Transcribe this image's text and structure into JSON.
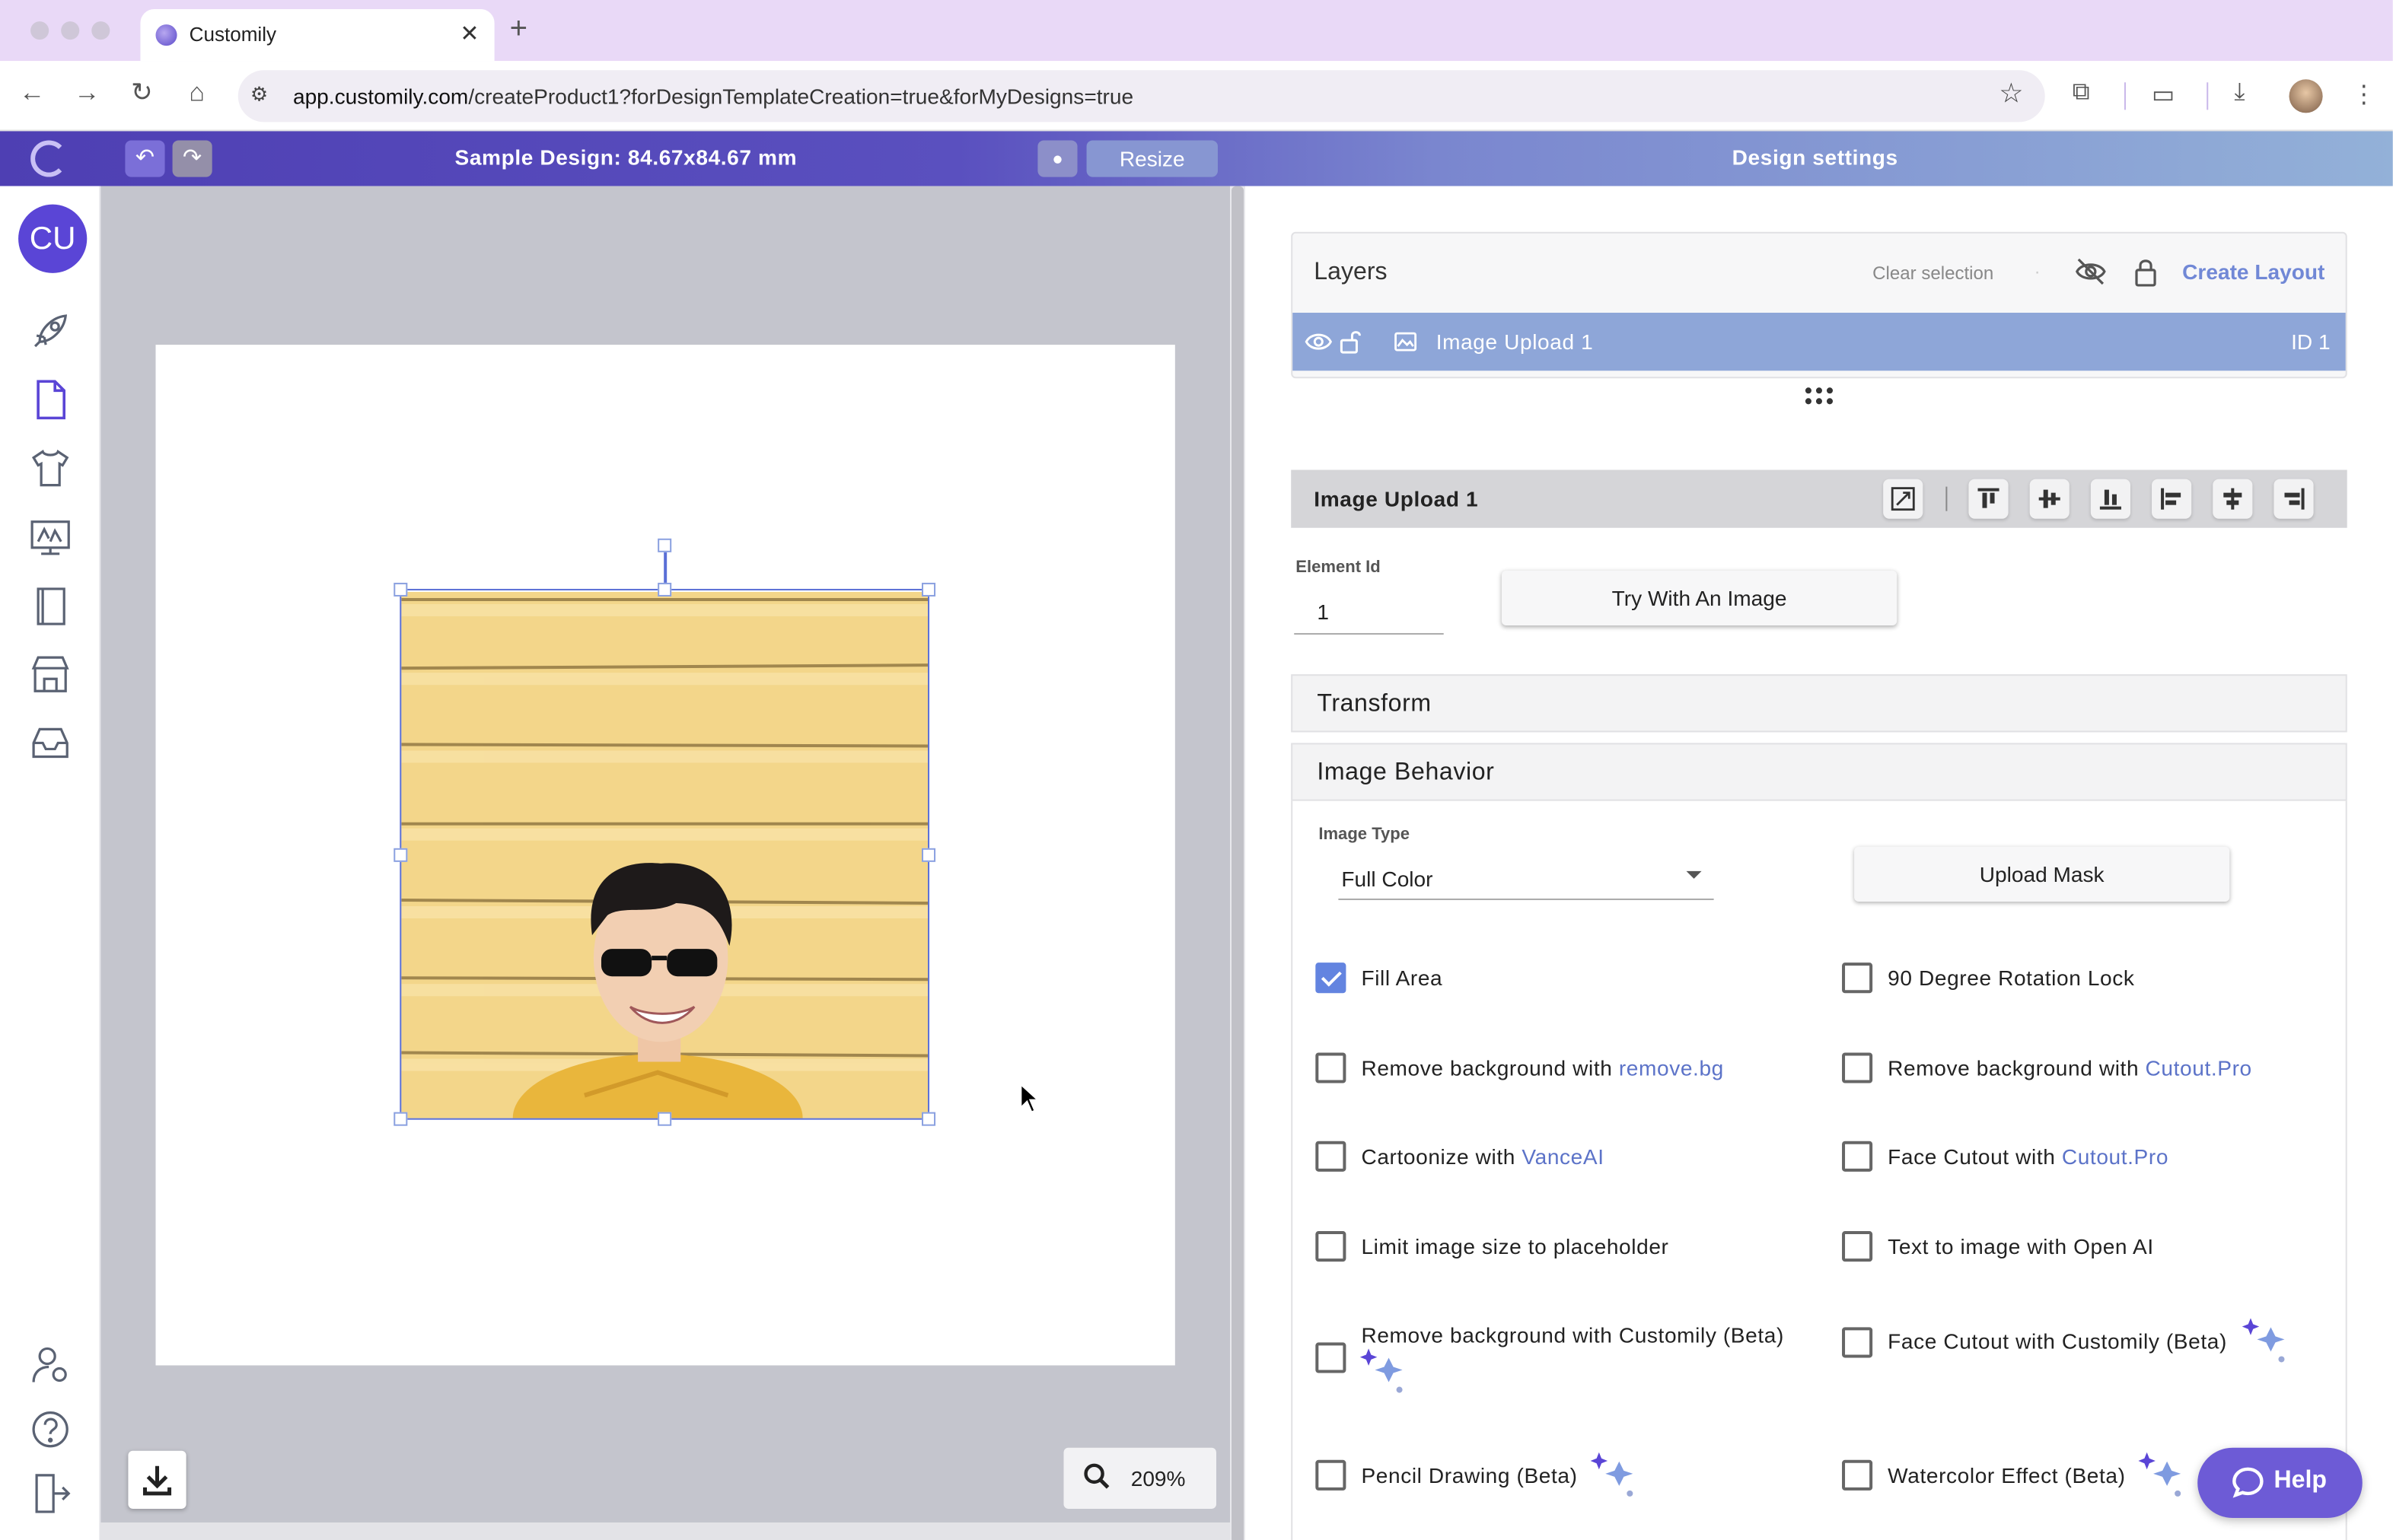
{
  "browser": {
    "tab_title": "Customily",
    "url_domain": "app.customily.com",
    "url_path": "/createProduct1?forDesignTemplateCreation=true&forMyDesigns=true"
  },
  "header": {
    "design_title": "Sample Design: 84.67x84.67 mm",
    "resize_label": "Resize",
    "settings_title": "Design settings"
  },
  "nav": {
    "avatar_initials": "CU"
  },
  "canvas": {
    "zoom": "209%"
  },
  "layers": {
    "title": "Layers",
    "clear_selection": "Clear selection",
    "dot": "·",
    "create_layout": "Create Layout",
    "items": [
      {
        "name": "Image Upload 1",
        "id_label": "ID 1"
      }
    ]
  },
  "element": {
    "title": "Image Upload 1",
    "id_label": "Element Id",
    "id_value": "1",
    "try_button": "Try With An Image"
  },
  "sections": {
    "transform": "Transform",
    "image_behavior": "Image Behavior"
  },
  "behavior": {
    "image_type_label": "Image Type",
    "image_type_value": "Full Color",
    "upload_mask": "Upload Mask",
    "options": {
      "fill_area": {
        "label": "Fill Area",
        "checked": true
      },
      "rotation_lock": {
        "label": "90 Degree Rotation Lock",
        "checked": false
      },
      "removebg": {
        "label": "Remove background with ",
        "link": "remove.bg",
        "checked": false
      },
      "cutoutpro_bg": {
        "label": "Remove background with ",
        "link": "Cutout.Pro",
        "checked": false
      },
      "cartoonize": {
        "label": "Cartoonize with ",
        "link": "VanceAI",
        "checked": false
      },
      "face_cutout_pro": {
        "label": "Face Cutout with ",
        "link": "Cutout.Pro",
        "checked": false
      },
      "limit_size": {
        "label": "Limit image size to placeholder",
        "checked": false
      },
      "text_to_image": {
        "label": "Text to image with Open AI",
        "checked": false
      },
      "customily_bg": {
        "label": "Remove background with Customily (Beta)",
        "checked": false
      },
      "customily_face": {
        "label": "Face Cutout with Customily (Beta)",
        "checked": false
      },
      "pencil": {
        "label": "Pencil Drawing (Beta)",
        "checked": false
      },
      "watercolor": {
        "label": "Watercolor Effect (Beta)",
        "checked": false
      }
    }
  },
  "help": {
    "label": "Help"
  },
  "colors": {
    "accent": "#6384e0",
    "header_start": "#4e3fb3",
    "header_end": "#93b1d8",
    "selected_layer": "#8ea6d8",
    "help_button": "#6d5bd6"
  }
}
